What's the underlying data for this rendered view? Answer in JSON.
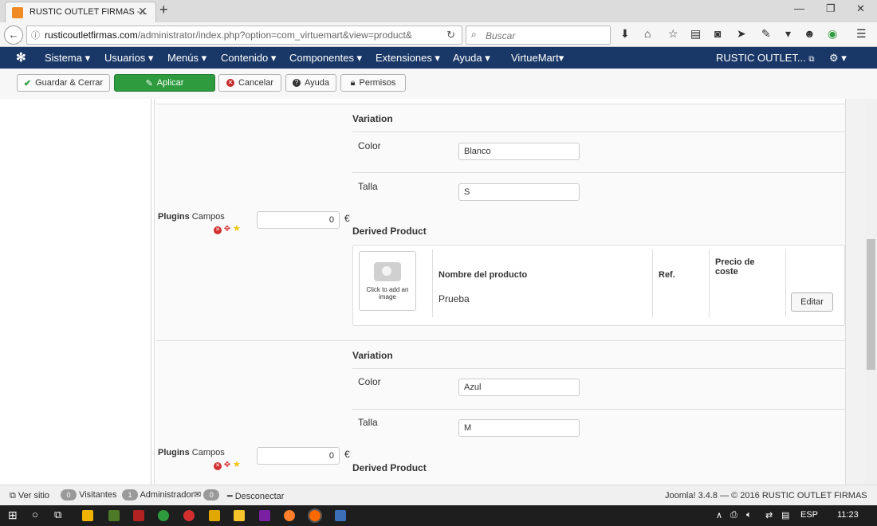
{
  "browser": {
    "tab_title": "RUSTIC OUTLET FIRMAS -...",
    "url_host": "rusticoutletfirmas.com",
    "url_path": "/administrator/index.php?option=com_virtuemart&view=product&",
    "search_placeholder": "Buscar"
  },
  "admin_menu": {
    "items": [
      "Sistema ▾",
      "Usuarios ▾",
      "Menús ▾",
      "Contenido ▾",
      "Componentes ▾",
      "Extensiones ▾",
      "Ayuda ▾",
      "VirtueMart▾"
    ],
    "site_name": "RUSTIC OUTLET..."
  },
  "toolbar": {
    "save_close": "Guardar & Cerrar",
    "apply": "Aplicar",
    "cancel": "Cancelar",
    "help": "Ayuda",
    "permissions": "Permisos"
  },
  "variations": [
    {
      "variation_title": "Variation",
      "color_label": "Color",
      "color_value": "Blanco",
      "size_label": "Talla",
      "size_value": "S",
      "plugins_bold": "Plugins",
      "plugins_rest": "Campos",
      "price": "0",
      "currency": "€",
      "derived_title": "Derived Product",
      "image_placeholder": "Click to add an image",
      "columns": [
        "Nombre del producto",
        "Ref.",
        "Precio de coste"
      ],
      "product_name": "Prueba",
      "edit_label": "Editar"
    },
    {
      "variation_title": "Variation",
      "color_label": "Color",
      "color_value": "Azul",
      "size_label": "Talla",
      "size_value": "M",
      "plugins_bold": "Plugins",
      "plugins_rest": "Campos",
      "price": "0",
      "currency": "€",
      "derived_title": "Derived Product"
    }
  ],
  "status_bar": {
    "view_site": "Ver sitio",
    "visitors_count": "0",
    "visitors_label": "Visitantes",
    "admins_count": "1",
    "admins_label": "Administrador",
    "messages_count": "0",
    "logout": "Desconectar",
    "footer": "Joomla! 3.4.8 — © 2016 RUSTIC OUTLET FIRMAS"
  },
  "taskbar": {
    "lang": "ESP",
    "time": "11:23"
  },
  "colors": {
    "admin_bar": "#1a3867",
    "apply_green": "#2e9c3e",
    "taskbar": "#1e1e1e"
  }
}
